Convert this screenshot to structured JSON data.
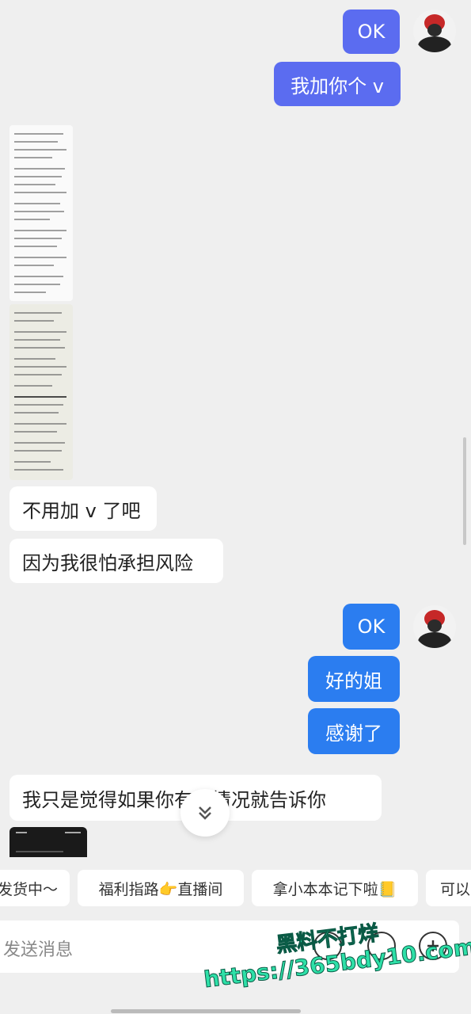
{
  "messages": {
    "ok_1": "OK",
    "add_v": "我加你个 v",
    "no_need_v": "不用加 v 了吧",
    "afraid_risk": "因为我很怕承担风险",
    "ok_2": "OK",
    "good_sis": "好的姐",
    "thanks": "感谢了",
    "just_feel": "我只是觉得如果你有的情况就告诉你"
  },
  "quick_replies": [
    "发货中～",
    "福利指路👉直播间",
    "拿小本本记下啦📒",
    "可以"
  ],
  "input": {
    "placeholder": "发送消息"
  },
  "watermark": {
    "line1": "黑料不打烊",
    "line2": "https://365bdy10.com"
  },
  "colors": {
    "outgoing_purple": "#5b6cf0",
    "outgoing_blue": "#2b7df0",
    "background": "#efefef"
  },
  "icons": [
    "avatar",
    "scroll-down-chevron-icon",
    "emoji-icon",
    "voice-icon",
    "plus-icon"
  ]
}
